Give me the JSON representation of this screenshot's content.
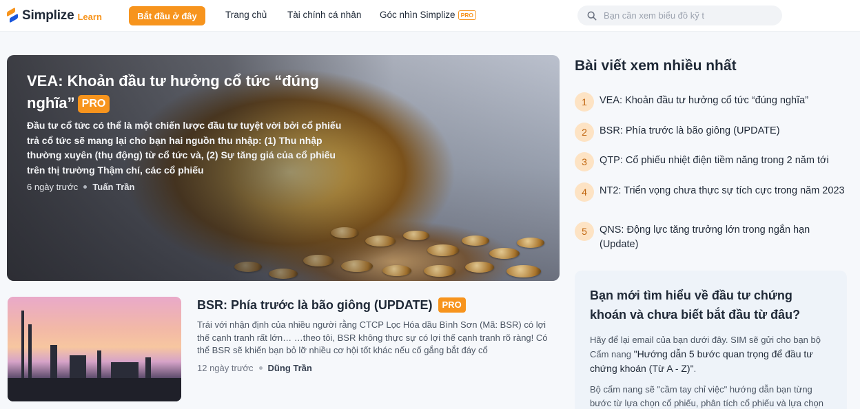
{
  "header": {
    "logo_text": "Simplize",
    "logo_sub": "Learn",
    "cta_label": "Bắt đầu ở đây",
    "nav": [
      {
        "label": "Trang chủ"
      },
      {
        "label": "Tài chính cá nhân"
      },
      {
        "label": "Góc nhìn Simplize",
        "badge": "PRO"
      }
    ],
    "search_placeholder": "Bạn cần xem biểu đồ kỹ t",
    "search_icon": "search-icon"
  },
  "hero": {
    "title": "VEA: Khoản đầu tư hưởng cổ tức “đúng nghĩa”",
    "badge": "PRO",
    "excerpt": "Đầu tư cổ tức có thể là một chiến lược đầu tư tuyệt vời bởi cổ phiếu trả cổ tức sẽ mang lại cho bạn hai nguồn thu nhập: (1) Thu nhập thường xuyên (thụ động) từ cổ tức và, (2) Sự tăng giá của cổ phiếu trên thị trường Thậm chí, các cổ phiếu",
    "time": "6 ngày trước",
    "author": "Tuấn Trần"
  },
  "article": {
    "title": "BSR: Phía trước là bão giông (UPDATE)",
    "badge": "PRO",
    "excerpt": "Trái với nhận định của nhiều người rằng CTCP Lọc Hóa dầu Bình Sơn (Mã: BSR) có lợi thế cạnh tranh rất lớn… …theo tôi, BSR không thực sự có lợi thế cạnh tranh rõ ràng! Có thể BSR sẽ khiến bạn bỏ lỡ nhiều cơ hội tốt khác nếu cố gắng bắt đáy cổ",
    "time": "12 ngày trước",
    "author": "Dũng Trần"
  },
  "sidebar": {
    "heading": "Bài viết xem nhiều nhất",
    "popular": [
      {
        "num": "1",
        "title": "VEA: Khoản đầu tư hưởng cổ tức “đúng nghĩa”"
      },
      {
        "num": "2",
        "title": "BSR: Phía trước là bão giông (UPDATE)"
      },
      {
        "num": "3",
        "title": "QTP: Cổ phiếu nhiệt điện tiềm năng trong 2 năm tới"
      },
      {
        "num": "4",
        "title": "NT2: Triển vọng chưa thực sự tích cực trong năm 2023"
      },
      {
        "num": "5",
        "title": "QNS: Động lực tăng trưởng lớn trong ngắn hạn (Update)"
      }
    ],
    "promo": {
      "title": "Bạn mới tìm hiểu về đầu tư chứng khoán và chưa biết bắt đầu từ đâu?",
      "text_before": "Hãy để lại email của bạn dưới đây. SIM sẽ gửi cho bạn bộ Cẩm nang ",
      "text_strong": "\"Hướng dẫn 5 bước quan trọng để đầu tư chứng khoán (Từ A - Z)\"",
      "text_after": ".",
      "text2": "Bộ cẩm nang sẽ \"cầm tay chỉ việc\" hướng dẫn bạn từng bước từ lựa chọn cổ phiếu, phân tích cổ phiếu và lựa chọn"
    }
  },
  "colors": {
    "accent": "#f7941d",
    "brand_blue": "#1a56db",
    "number_bg": "#fde3c4",
    "promo_bg": "#eef3f9"
  }
}
